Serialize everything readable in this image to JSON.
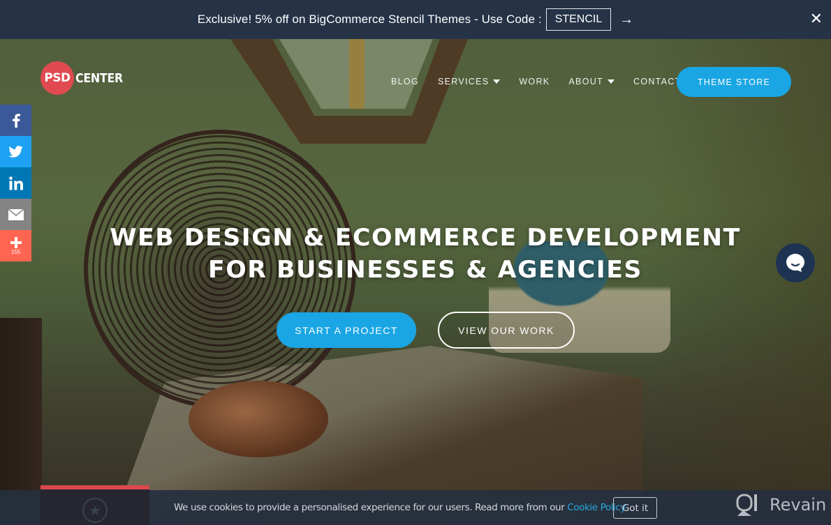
{
  "promo": {
    "text": "Exclusive! 5% off on BigCommerce Stencil Themes - Use Code :",
    "code": "STENCIL",
    "arrow": "→",
    "close": "✕"
  },
  "header": {
    "logo_circle": "PSD",
    "logo_text": "CENTER",
    "nav": [
      {
        "label": "BLOG",
        "dropdown": false
      },
      {
        "label": "SERVICES",
        "dropdown": true
      },
      {
        "label": "WORK",
        "dropdown": false
      },
      {
        "label": "ABOUT",
        "dropdown": true
      },
      {
        "label": "CONTACT",
        "dropdown": false
      }
    ],
    "theme_store": "THEME STORE"
  },
  "social": {
    "share_count": "155",
    "icons": [
      "facebook-icon",
      "twitter-icon",
      "linkedin-icon",
      "email-icon",
      "share-plus-icon"
    ]
  },
  "hero": {
    "headline_line1": "WEB DESIGN & ECOMMERCE DEVELOPMENT",
    "headline_line2": "FOR BUSINESSES & AGENCIES",
    "cta_primary": "START A PROJECT",
    "cta_secondary": "VIEW OUR WORK"
  },
  "cookie": {
    "text": "We use cookies to provide a personalised experience for our users. Read more from our ",
    "link": "Cookie Policy",
    "button": "Got it"
  },
  "watermark": {
    "text": "Revain"
  },
  "colors": {
    "accent": "#1aa6e4",
    "brand_red": "#e04a50",
    "promo_bg": "#263347",
    "facebook": "#3b5998",
    "twitter": "#1da1f2",
    "linkedin": "#0077b5",
    "email": "#848484",
    "share": "#ff6550"
  }
}
